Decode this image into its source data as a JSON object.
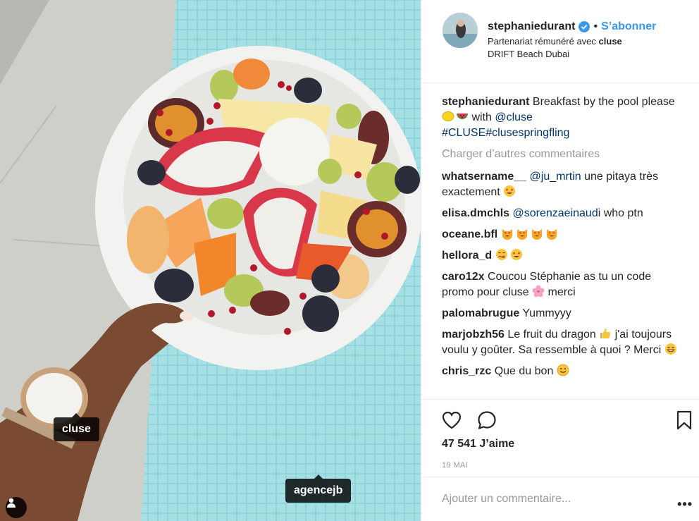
{
  "photo": {
    "tags": [
      "cluse",
      "agencejb"
    ]
  },
  "header": {
    "username": "stephaniedurant",
    "separator": "•",
    "follow_label": "S’abonner",
    "partnership_prefix": "Partenariat rémunéré avec ",
    "partner": "cluse",
    "location": "DRIFT Beach Dubai"
  },
  "caption": {
    "user": "stephaniedurant",
    "text_part1": " Breakfast by the pool please ",
    "text_part2": " with ",
    "mention": "@cluse",
    "hashtags": "#CLUSE#clusespringfling"
  },
  "load_more": "Charger d’autres commentaires",
  "comments": [
    {
      "user": "whatsername__",
      "mention": "@ju_mrtin",
      "text": " une pitaya très exactement "
    },
    {
      "user": "elisa.dmchls",
      "mention": "@sorenzaeinaudi",
      "text": " who ptn"
    },
    {
      "user": "oceane.bfl",
      "text": " "
    },
    {
      "user": "hellora_d",
      "text": " "
    },
    {
      "user": "caro12x",
      "text": " Coucou Stéphanie as tu un code promo pour cluse ",
      "text_after": " merci"
    },
    {
      "user": "palomabrugue",
      "text": " Yummyyy"
    },
    {
      "user": "marjobzh56",
      "text": " Le fruit du dragon ",
      "text_after": " j'ai toujours voulu y goûter. Sa ressemble à quoi ? Merci "
    },
    {
      "user": "chris_rzc",
      "text": " Que du bon "
    }
  ],
  "likes": "47 541 J’aime",
  "date": "19 MAI",
  "add_comment_placeholder": "Ajouter un commentaire...",
  "more_label": "•••",
  "colors": {
    "accent": "#3897f0",
    "mention": "#003569",
    "muted": "#999999"
  }
}
